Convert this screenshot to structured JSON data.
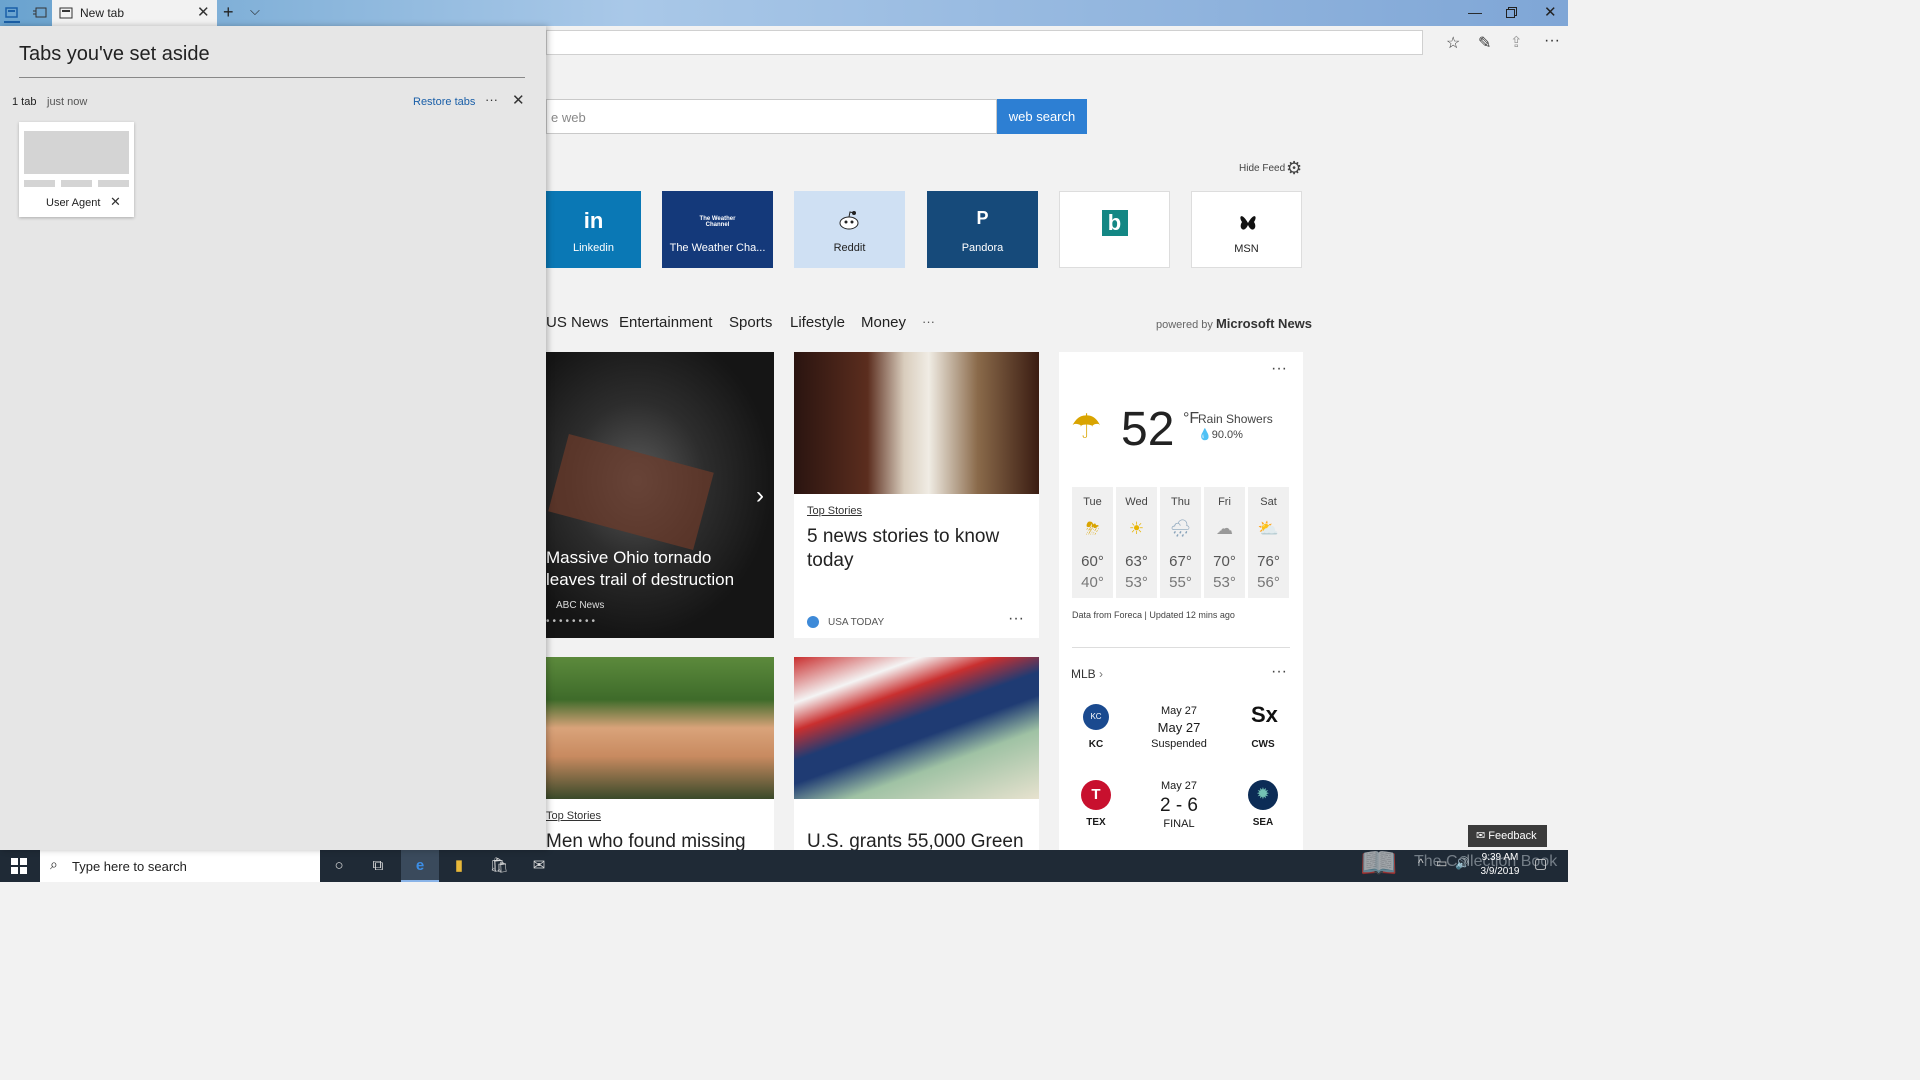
{
  "browser": {
    "tab_title": "New tab",
    "window_controls": [
      "minimize",
      "restore",
      "close"
    ]
  },
  "aside_panel": {
    "title": "Tabs you've set aside",
    "count": "1 tab",
    "time": "just now",
    "restore_label": "Restore tabs",
    "more": "···",
    "card_title": "User Agent"
  },
  "search": {
    "placeholder": "e web",
    "button": "web search"
  },
  "feed": {
    "hide_feed": "Hide Feed",
    "powered_by_prefix": "powered by",
    "powered_by_brand": "Microsoft News"
  },
  "tiles": [
    {
      "label": "Linkedin",
      "icon": "in",
      "bg": "#0a78b5",
      "fg": "#ffffff"
    },
    {
      "label": "The Weather Cha...",
      "icon": "The Weather Channel",
      "bg": "#14397a",
      "fg": "#ffffff"
    },
    {
      "label": "Reddit",
      "icon": "reddit-icon",
      "bg": "#cfe0f3",
      "fg": "#222222"
    },
    {
      "label": "Pandora",
      "icon": "P",
      "bg": "#164a7a",
      "fg": "#ffffff"
    },
    {
      "label": "",
      "icon": "b",
      "bg": "#ffffff",
      "fg": "#138784"
    },
    {
      "label": "MSN",
      "icon": "msn-icon",
      "bg": "#ffffff",
      "fg": "#222222"
    }
  ],
  "categories": [
    "US News",
    "Entertainment",
    "Sports",
    "Lifestyle",
    "Money",
    "···"
  ],
  "cards": {
    "hero": {
      "title": "Massive Ohio tornado leaves trail of destruction",
      "source": "ABC News"
    },
    "story1": {
      "tag": "Top Stories",
      "title": "5 news stories to know today",
      "source": "USA TODAY"
    },
    "story2": {
      "tag": "Top Stories",
      "title": "Men who found missing"
    },
    "story3": {
      "title": "U.S. grants 55,000 Green"
    }
  },
  "weather": {
    "temp": "52",
    "unit": "°F",
    "condition": "Rain Showers",
    "precip": "90.0%",
    "forecast": [
      {
        "day": "Tue",
        "hi": "60°",
        "lo": "40°"
      },
      {
        "day": "Wed",
        "hi": "63°",
        "lo": "53°"
      },
      {
        "day": "Thu",
        "hi": "67°",
        "lo": "55°"
      },
      {
        "day": "Fri",
        "hi": "70°",
        "lo": "53°"
      },
      {
        "day": "Sat",
        "hi": "76°",
        "lo": "56°"
      }
    ],
    "credit": "Data from Foreca | Updated 12 mins ago"
  },
  "mlb": {
    "title": "MLB",
    "games": [
      {
        "home": "KC",
        "away": "CWS",
        "line1": "May 27",
        "line2": "May 27",
        "status": "Suspended"
      },
      {
        "home": "TEX",
        "away": "SEA",
        "line1": "May 27",
        "score": "2 - 6",
        "status": "FINAL"
      }
    ]
  },
  "feedback": "Feedback",
  "taskbar": {
    "search_placeholder": "Type here to search",
    "time": "9:39 AM",
    "date": "3/9/2019",
    "watermark": "The Collection Book"
  }
}
